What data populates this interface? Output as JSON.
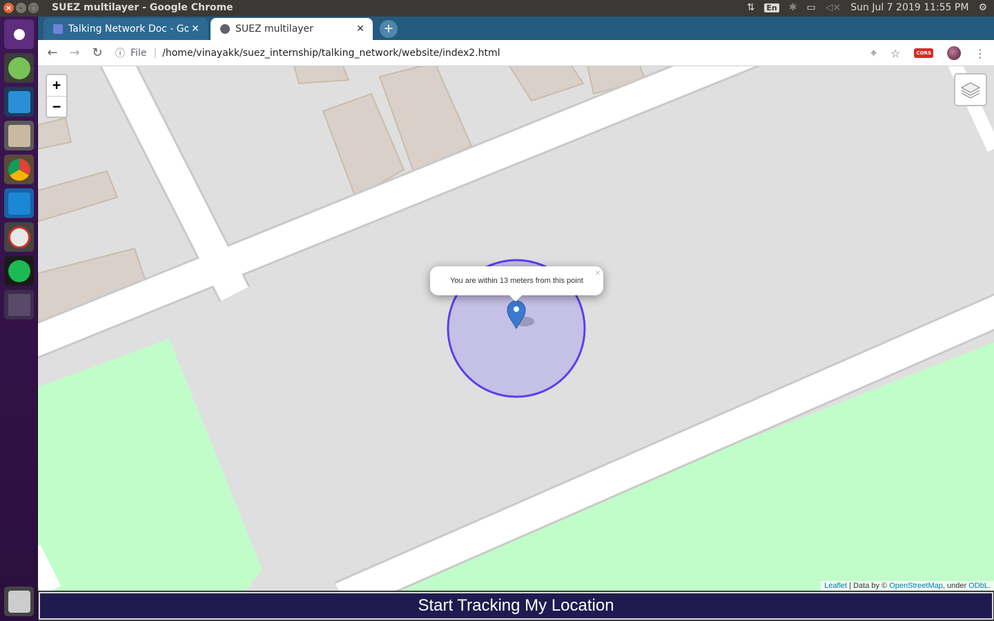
{
  "system": {
    "window_title": "SUEZ multilayer - Google Chrome",
    "keyboard_layout": "En",
    "datetime": "Sun Jul  7 2019 11:55 PM"
  },
  "launcher": {
    "apps": [
      "ubuntu-dash",
      "android-studio",
      "vscode",
      "files",
      "chrome",
      "virtualbox",
      "network-tool",
      "spotify",
      "workspace-switcher",
      "trash"
    ]
  },
  "browser": {
    "tabs": [
      {
        "label": "Talking Network Doc - Goo",
        "icon": "google-docs-icon",
        "active": false
      },
      {
        "label": "SUEZ multilayer",
        "icon": "globe-icon",
        "active": true
      }
    ],
    "close_glyph": "✕",
    "new_tab_glyph": "+",
    "address": {
      "scheme_label": "File",
      "url": "/home/vinayakk/suez_internship/talking_network/website/index2.html"
    },
    "extension_badge": "CORS"
  },
  "map": {
    "zoom_in": "+",
    "zoom_out": "−",
    "popup_text": "You are within 13 meters from this point",
    "popup_close": "×",
    "attribution": {
      "leaflet": "Leaflet",
      "data_by": " | Data by © ",
      "osm": "OpenStreetMap",
      "under": ", under ",
      "license": "ODbL",
      "end": "."
    },
    "colors": {
      "accuracy_circle_fill": "#c5c0e6",
      "accuracy_circle_stroke": "#5b3ef0",
      "marker": "#3a7ad1",
      "park": "#c0fdc9",
      "building": "#d9d0c9",
      "road": "#ffffff"
    }
  },
  "action": {
    "track_button_label": "Start Tracking My Location"
  }
}
